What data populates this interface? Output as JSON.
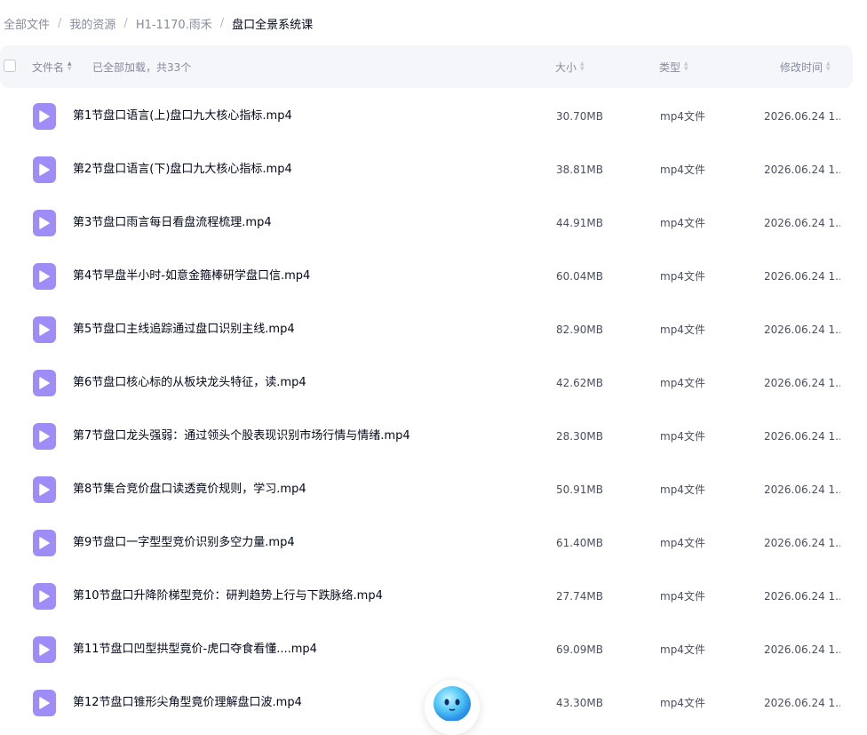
{
  "breadcrumb": [
    {
      "label": "全部文件"
    },
    {
      "label": "我的资源"
    },
    {
      "label": "H1-1170.雨禾"
    },
    {
      "label": "盘口全景系统课"
    }
  ],
  "breadcrumb_separator": "/",
  "header": {
    "name_label": "文件名",
    "loaded_text": "已全部加载，共33个",
    "size_label": "大小",
    "type_label": "类型",
    "modified_label": "修改时间"
  },
  "files": [
    {
      "name": "第1节盘口语言(上)盘口九大核心指标.mp4",
      "size": "30.70MB",
      "type": "mp4文件",
      "modified": "2026.06.24 1..."
    },
    {
      "name": "第2节盘口语言(下)盘口九大核心指标.mp4",
      "size": "38.81MB",
      "type": "mp4文件",
      "modified": "2026.06.24 1..."
    },
    {
      "name": "第3节盘口雨言每日看盘流程梳理.mp4",
      "size": "44.91MB",
      "type": "mp4文件",
      "modified": "2026.06.24 1..."
    },
    {
      "name": "第4节早盘半小时-如意金箍棒研学盘口信.mp4",
      "size": "60.04MB",
      "type": "mp4文件",
      "modified": "2026.06.24 1..."
    },
    {
      "name": "第5节盘口主线追踪通过盘口识别主线.mp4",
      "size": "82.90MB",
      "type": "mp4文件",
      "modified": "2026.06.24 1..."
    },
    {
      "name": "第6节盘口核心标的从板块龙头特征，读.mp4",
      "size": "42.62MB",
      "type": "mp4文件",
      "modified": "2026.06.24 1..."
    },
    {
      "name": "第7节盘口龙头强弱：通过领头个股表现识别市场行情与情绪.mp4",
      "size": "28.30MB",
      "type": "mp4文件",
      "modified": "2026.06.24 1..."
    },
    {
      "name": "第8节集合竞价盘口读透竟价规则，学习.mp4",
      "size": "50.91MB",
      "type": "mp4文件",
      "modified": "2026.06.24 1..."
    },
    {
      "name": "第9节盘口一字型型竞价识别多空力量.mp4",
      "size": "61.40MB",
      "type": "mp4文件",
      "modified": "2026.06.24 1..."
    },
    {
      "name": "第10节盘口升降阶梯型竞价：研判趋势上行与下跌脉络.mp4",
      "size": "27.74MB",
      "type": "mp4文件",
      "modified": "2026.06.24 1..."
    },
    {
      "name": "第11节盘口凹型拱型竟价-虎口夺食看懂....mp4",
      "size": "69.09MB",
      "type": "mp4文件",
      "modified": "2026.06.24 1..."
    },
    {
      "name": "第12节盘口锥形尖角型竟价理解盘口波.mp4",
      "size": "43.30MB",
      "type": "mp4文件",
      "modified": "2026.06.24 1..."
    }
  ],
  "icons": {
    "file_icon": "video-file-icon",
    "mascot": "assistant-mascot-icon"
  },
  "colors": {
    "accent_purple": "#a08cf7",
    "header_bg": "#f5f6fa",
    "text_primary": "#03081a",
    "text_secondary": "#878c9c"
  }
}
